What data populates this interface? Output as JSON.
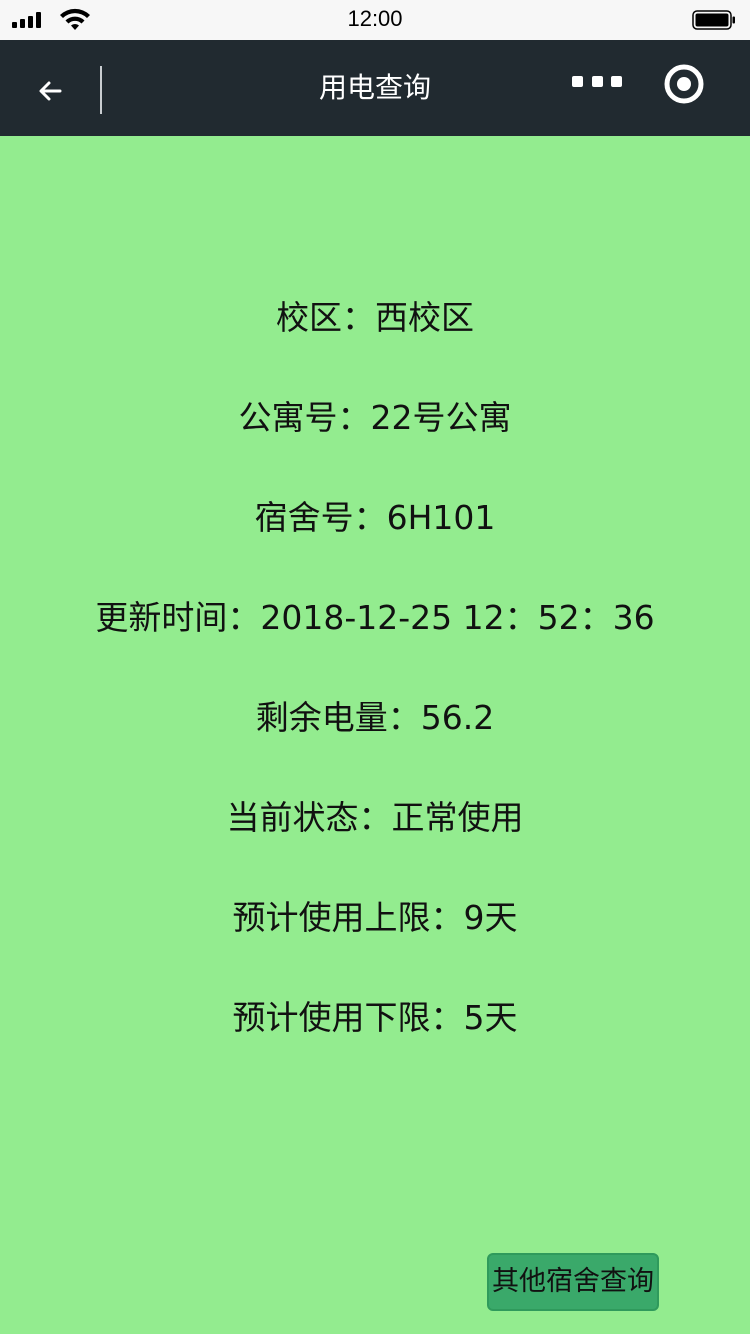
{
  "status_bar": {
    "time": "12:00"
  },
  "nav": {
    "title": "用电查询",
    "back_icon": "back-arrow-icon",
    "more_icon": "more-dots-icon",
    "target_icon": "target-icon"
  },
  "info": {
    "campus": "校区：西校区",
    "apartment": "公寓号：22号公寓",
    "dorm": "宿舍号：6H101",
    "update_time": "更新时间：2018-12-25 12：52：36",
    "remaining_power": "剩余电量：56.2",
    "status": "当前状态：正常使用",
    "upper_limit": "预计使用上限：9天",
    "lower_limit": "预计使用下限：5天"
  },
  "actions": {
    "other_dorm_query": "其他宿舍查询"
  },
  "colors": {
    "background": "#93ec8f",
    "nav_background": "#212a30",
    "button_background": "#3aa96a"
  }
}
